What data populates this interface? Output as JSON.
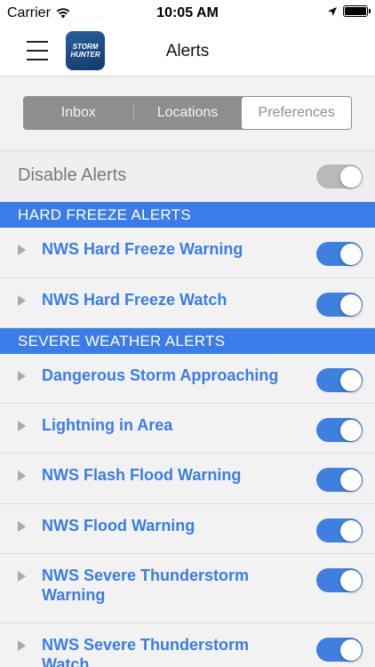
{
  "status_bar": {
    "carrier": "Carrier",
    "time": "10:05 AM"
  },
  "nav": {
    "title": "Alerts",
    "logo_text": "STORM HUNTER"
  },
  "tabs": [
    {
      "label": "Inbox",
      "selected": false
    },
    {
      "label": "Locations",
      "selected": false
    },
    {
      "label": "Preferences",
      "selected": true
    }
  ],
  "disable_alerts": {
    "label": "Disable Alerts",
    "on": false
  },
  "sections": [
    {
      "title": "HARD FREEZE ALERTS",
      "items": [
        {
          "label": "NWS Hard Freeze Warning",
          "on": true
        },
        {
          "label": "NWS Hard Freeze Watch",
          "on": true
        }
      ]
    },
    {
      "title": "SEVERE WEATHER ALERTS",
      "items": [
        {
          "label": "Dangerous Storm Approaching",
          "on": true
        },
        {
          "label": "Lightning in Area",
          "on": true
        },
        {
          "label": "NWS Flash Flood Warning",
          "on": true
        },
        {
          "label": "NWS Flood Warning",
          "on": true
        },
        {
          "label": "NWS Severe Thunderstorm Warning",
          "on": true
        },
        {
          "label": "NWS Severe Thunderstorm Watch",
          "on": true
        }
      ]
    }
  ],
  "colors": {
    "accent": "#3a7de8",
    "toggle_on": "#3f7fe0",
    "toggle_off": "#b9b9b9",
    "segment_bg": "#8e8e8e"
  }
}
